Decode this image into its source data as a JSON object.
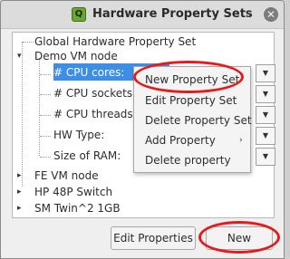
{
  "window": {
    "title": "Hardware Property Sets",
    "app_icon": "Q",
    "minimize_glyph": "⌄",
    "close_glyph": "✕"
  },
  "tree": {
    "root_items": [
      {
        "label": "Global Hardware Property Set",
        "expander": ""
      },
      {
        "label": "Demo VM node",
        "expander": "▾"
      },
      {
        "label": "FE VM node",
        "expander": "▸"
      },
      {
        "label": "HP 48P Switch",
        "expander": "▸"
      },
      {
        "label": "SM Twin^2 1GB",
        "expander": "▸"
      }
    ],
    "demo_children": [
      {
        "label": "# CPU cores:",
        "selected": true
      },
      {
        "label": "# CPU sockets"
      },
      {
        "label": "# CPU threads"
      },
      {
        "label": "HW Type:"
      },
      {
        "label": "Size of RAM:"
      }
    ],
    "combo_arrow": "▼"
  },
  "context_menu": {
    "items": [
      {
        "label": "New Property Set"
      },
      {
        "label": "Edit Property Set"
      },
      {
        "label": "Delete Property Set"
      },
      {
        "label": "Add Property",
        "submenu_arrow": "›"
      },
      {
        "label": "Delete property"
      }
    ]
  },
  "buttons": {
    "edit_properties": "Edit Properties",
    "new": "New"
  },
  "annotation_color": "#e51b1b",
  "selection_color": "#3d8ee6"
}
